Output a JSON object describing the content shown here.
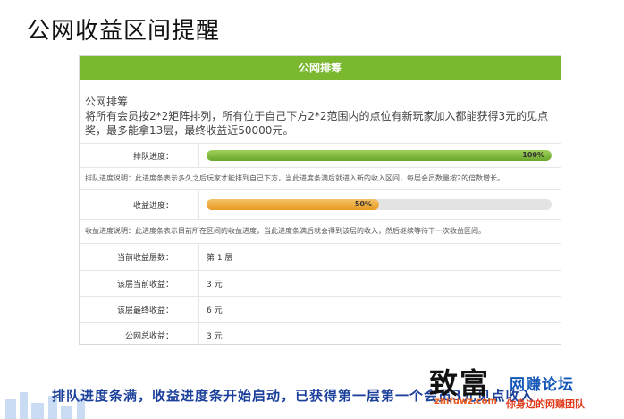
{
  "slide": {
    "title": "公网收益区间提醒",
    "footer": "排队进度条满，收益进度条开始启动，已获得第一层第一个会员3元见点收入"
  },
  "panel": {
    "header": "公网排筹",
    "intro_title": "公网排筹",
    "intro_text": "将所有会员按2*2矩阵排列，所有位于自己下方2*2范围内的点位有新玩家加入都能获得3元的见点奖，最多能拿13层，最终收益近50000元。",
    "queue_progress": {
      "label": "排队进度：",
      "value": 100,
      "text": "100%",
      "color": "#7ab830"
    },
    "queue_note": "排队进度说明：此进度条表示多久之后玩家才能排到自己下方，当此进度条满后就进入新的收入区间，每层会员数量按2的倍数增长。",
    "income_progress": {
      "label": "收益进度：",
      "value": 50,
      "text": "50%",
      "color": "#e89a22"
    },
    "income_note": "收益进度说明：此进度条表示目前所在区间的收益进度，当此进度条满后就会得到该层的收入，然后继续等待下一次收益区间。",
    "stats": [
      {
        "label": "当前收益层数：",
        "value": "第 1 层"
      },
      {
        "label": "该层当前收益：",
        "value": "3 元"
      },
      {
        "label": "该层最终收益：",
        "value": "6 元"
      },
      {
        "label": "公网总收益：",
        "value": "3 元"
      }
    ]
  },
  "watermark": {
    "big": "致富",
    "small": "网赚论坛",
    "url": "zhifuwz.com",
    "slogan": "你身边的网赚团队"
  }
}
